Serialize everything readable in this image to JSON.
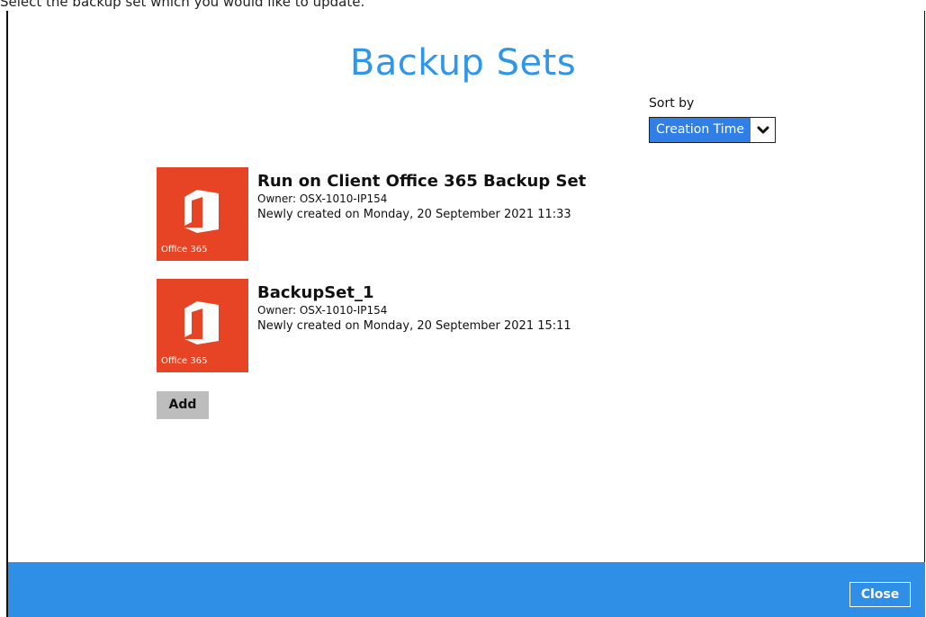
{
  "instruction": "Select the backup set which you would like to update.",
  "window": {
    "title": "Backup Sets"
  },
  "sort": {
    "label": "Sort by",
    "selected": "Creation Time",
    "icon": "chevron-down-icon"
  },
  "backup_sets": [
    {
      "name": "Run on Client Office 365 Backup Set",
      "owner": "Owner: OSX-1010-IP154",
      "created": "Newly created on Monday, 20 September 2021 11:33",
      "tile_label": "Office 365",
      "icon": "office365-icon"
    },
    {
      "name": "BackupSet_1",
      "owner": "Owner: OSX-1010-IP154",
      "created": "Newly created on Monday, 20 September 2021 15:11",
      "tile_label": "Office 365",
      "icon": "office365-icon"
    }
  ],
  "buttons": {
    "add": "Add",
    "close": "Close"
  },
  "colors": {
    "title": "#2f96e8",
    "footer": "#2f8ee6",
    "tile": "#e64424",
    "sort_highlight": "#2f7fe6",
    "add_button": "#bdbdbd"
  }
}
